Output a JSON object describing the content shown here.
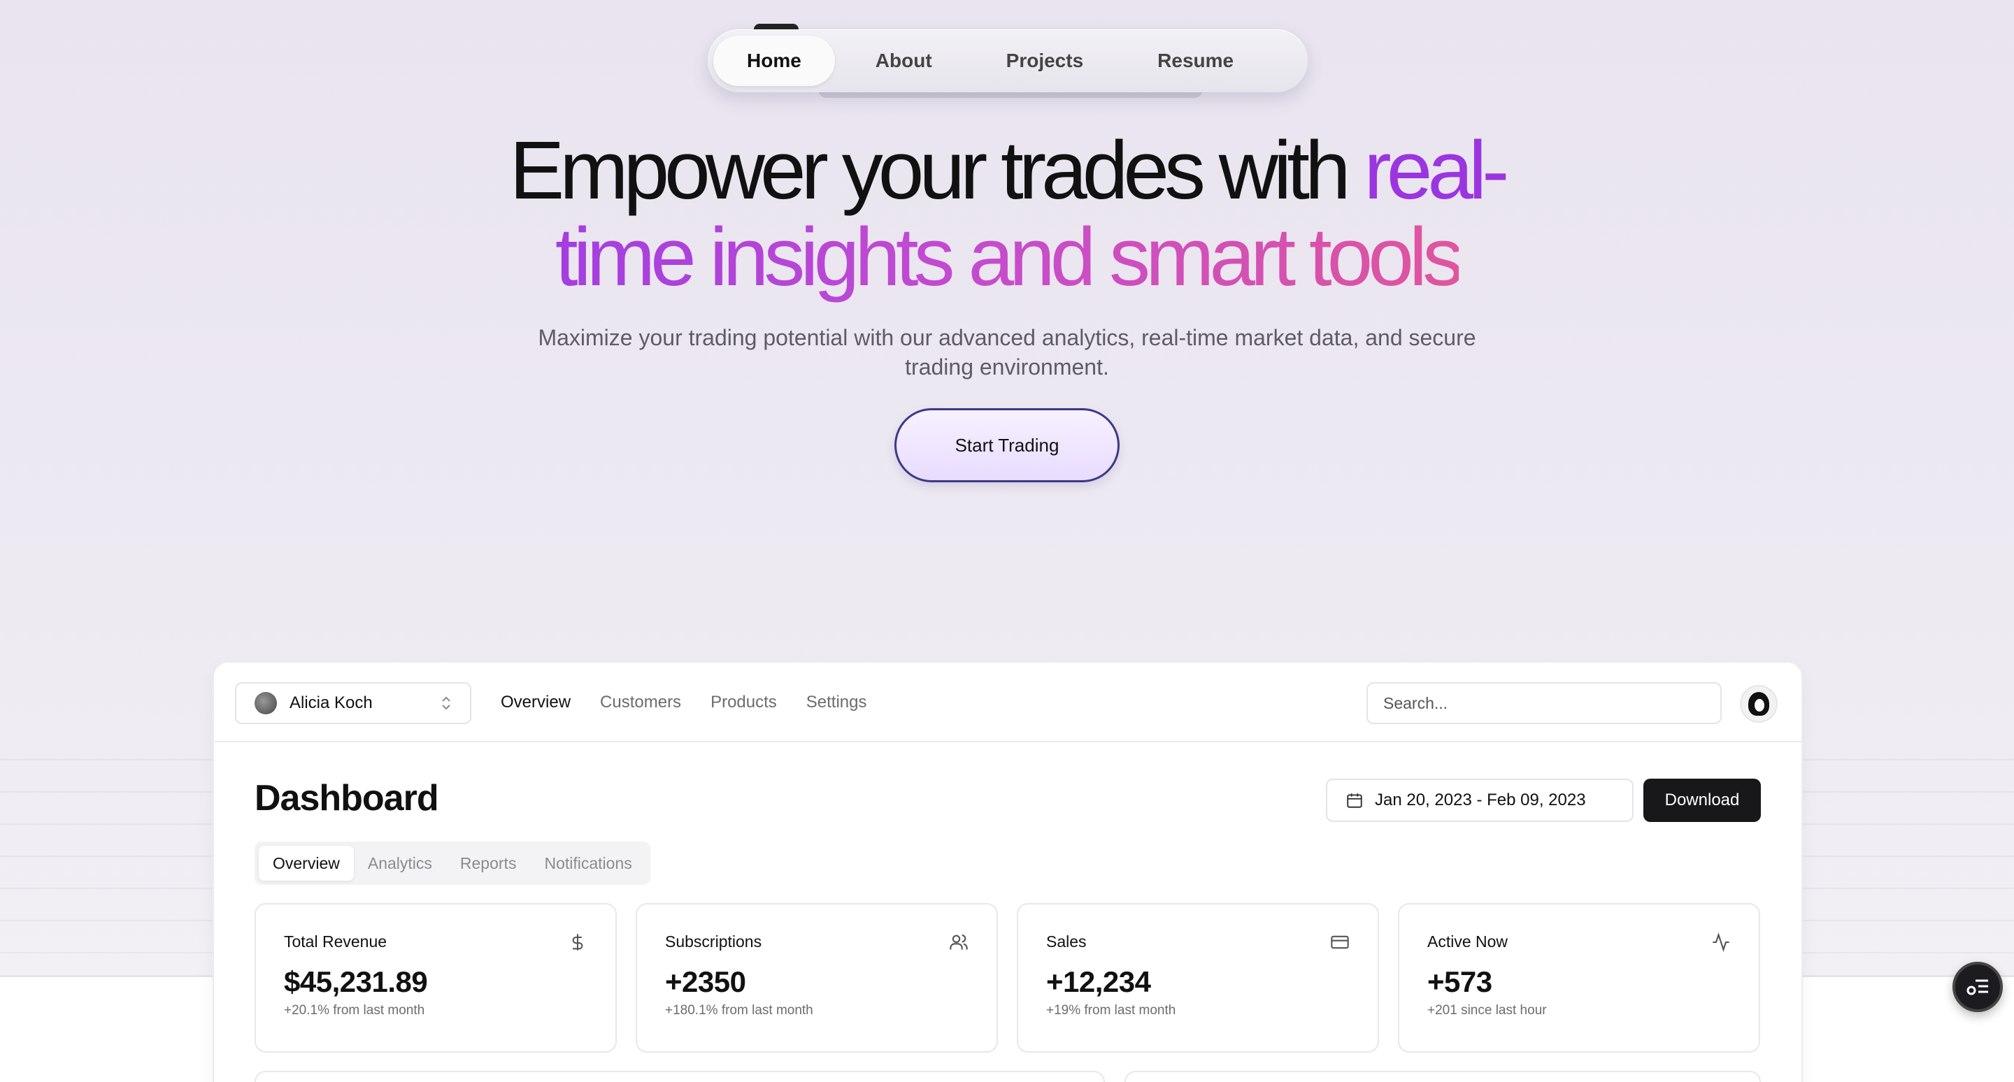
{
  "nav": {
    "items": [
      {
        "label": "Home",
        "active": true
      },
      {
        "label": "About",
        "active": false
      },
      {
        "label": "Projects",
        "active": false
      },
      {
        "label": "Resume",
        "active": false
      }
    ]
  },
  "hero": {
    "title_plain": "Empower your trades with ",
    "title_accent_1": "real-",
    "title_accent_2": "time insights and smart tools",
    "subtitle": "Maximize your trading potential with our advanced analytics, real-time market data, and secure trading environment.",
    "cta_label": "Start Trading"
  },
  "dashboard": {
    "team_name": "Alicia Koch",
    "top_nav": [
      "Overview",
      "Customers",
      "Products",
      "Settings"
    ],
    "search_placeholder": "Search...",
    "title": "Dashboard",
    "date_range": "Jan 20, 2023 - Feb 09, 2023",
    "download_label": "Download",
    "tabs": [
      "Overview",
      "Analytics",
      "Reports",
      "Notifications"
    ],
    "stats": [
      {
        "title": "Total Revenue",
        "value": "$45,231.89",
        "note": "+20.1% from last month",
        "icon": "dollar-icon"
      },
      {
        "title": "Subscriptions",
        "value": "+2350",
        "note": "+180.1% from last month",
        "icon": "users-icon"
      },
      {
        "title": "Sales",
        "value": "+12,234",
        "note": "+19% from last month",
        "icon": "credit-card-icon"
      },
      {
        "title": "Active Now",
        "value": "+573",
        "note": "+201 since last hour",
        "icon": "activity-icon"
      }
    ]
  },
  "colors": {
    "accent_purple": "#9b35e0",
    "accent_pink": "#e0559e",
    "button_dark": "#18181b",
    "cta_border": "#3c3a85"
  }
}
